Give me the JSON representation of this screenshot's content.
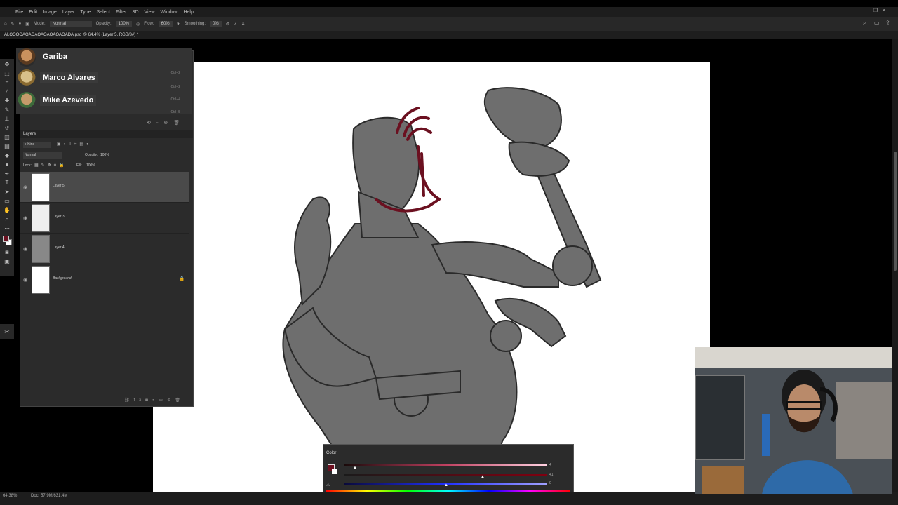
{
  "app": {
    "menu": [
      "File",
      "Edit",
      "Image",
      "Layer",
      "Type",
      "Select",
      "Filter",
      "3D",
      "View",
      "Window",
      "Help"
    ],
    "logo_text": "Ps"
  },
  "options_bar": {
    "mode_label": "Mode:",
    "mode_value": "Normal",
    "opacity_label": "Opacity:",
    "opacity_value": "100%",
    "flow_label": "Flow:",
    "flow_value": "60%",
    "smoothing_label": "Smoothing:",
    "smoothing_value": "0%"
  },
  "document_tab": "ALOOOOAOAOAOAOAOAOAOADA.psd @ 64,4% (Layer 5, RGB/8#) *",
  "swatch_panel": {
    "rows": [
      {
        "name": "Gariba",
        "shortcut": ""
      },
      {
        "name": "Marco Alvares",
        "shortcut": "Ctrl+2"
      },
      {
        "name": "Mike Azevedo",
        "shortcut": "Ctrl+4"
      }
    ],
    "extra_shortcuts": [
      "Ctrl+2",
      "Ctrl+5"
    ]
  },
  "layers_panel": {
    "title": "Layers",
    "kind_label": "Kind",
    "blend_mode": "Normal",
    "opacity_label": "Opacity:",
    "opacity_value": "100%",
    "lock_label": "Lock:",
    "fill_label": "Fill:",
    "fill_value": "100%",
    "layers": [
      {
        "name": "Layer 5",
        "selected": true
      },
      {
        "name": "Layer 3",
        "selected": false
      },
      {
        "name": "Layer 4",
        "selected": false
      },
      {
        "name": "Background",
        "selected": false
      }
    ]
  },
  "color_panel": {
    "title": "Color",
    "values": [
      "4",
      "41",
      "0"
    ]
  },
  "status_bar": {
    "zoom": "64,38%",
    "doc": "Doc: 57,9M/631,4M"
  },
  "colors": {
    "foreground": "#6b1020",
    "background": "#ffffff"
  }
}
